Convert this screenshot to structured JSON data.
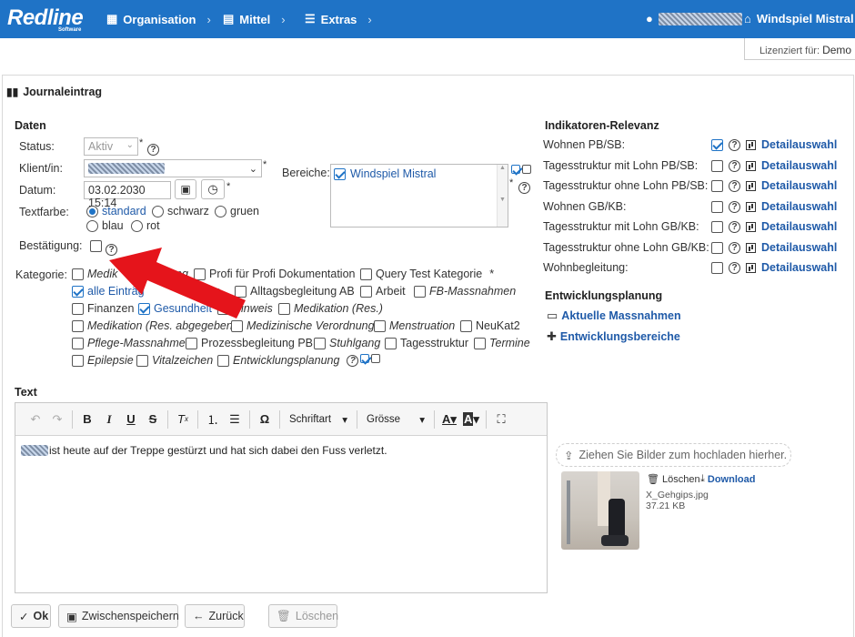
{
  "nav": {
    "logo": "Redline",
    "logo_sub": "Software",
    "items": [
      {
        "label": "Organisation",
        "icon": "building-icon"
      },
      {
        "label": "Mittel",
        "icon": "folder-icon"
      },
      {
        "label": "Extras",
        "icon": "menu-icon"
      }
    ],
    "home": "Windspiel Mistral"
  },
  "license": {
    "prefix": "Lizenziert für:",
    "name": "Demo"
  },
  "page_title": "Journaleintrag",
  "daten": {
    "title": "Daten",
    "status_label": "Status:",
    "status_value": "Aktiv",
    "klient_label": "Klient/in:",
    "datum_label": "Datum:",
    "datum_value": "03.02.2030 15:14",
    "textfarbe_label": "Textfarbe:",
    "colors": [
      "standard",
      "schwarz",
      "gruen",
      "blau",
      "rot"
    ],
    "bestaetigung_label": "Bestätigung:",
    "bereiche_label": "Bereiche:",
    "bereiche_item": "Windspiel Mistral",
    "required": "*"
  },
  "kategorie": {
    "label": "Kategorie:",
    "items": [
      "Medik",
      "ng",
      "Profi für Profi Dokumentation",
      "Query Test Kategorie",
      "alle Einträg",
      "e",
      "Alltagsbegleitung AB",
      "Arbeit",
      "FB-Massnahmen",
      "Finanzen",
      "Gesundheit",
      "Hinweis",
      "Medikation (Res.)",
      "Medikation (Res. abgegeben)",
      "Medizinische Verordnung",
      "Menstruation",
      "NeuKat2",
      "Pflege-Massnahme",
      "Prozessbegleitung PB",
      "Stuhlgang",
      "Tagesstruktur",
      "Termine",
      "Epilepsie",
      "Vitalzeichen",
      "Entwicklungsplanung"
    ]
  },
  "indikatoren": {
    "title": "Indikatoren-Relevanz",
    "link": "Detailauswahl",
    "rows": [
      "Wohnen PB/SB:",
      "Tagesstruktur mit Lohn PB/SB:",
      "Tagesstruktur ohne Lohn PB/SB:",
      "Wohnen GB/KB:",
      "Tagesstruktur mit Lohn GB/KB:",
      "Tagesstruktur ohne Lohn GB/KB:",
      "Wohnbegleitung:"
    ]
  },
  "entwicklung": {
    "title": "Entwicklungsplanung",
    "links": [
      "Aktuelle Massnahmen",
      "Entwicklungsbereiche"
    ]
  },
  "text": {
    "title": "Text",
    "toolbar": {
      "font": "Schriftart",
      "size": "Grösse",
      "omega": "Ω"
    },
    "body": "ist heute auf der Treppe gestürzt und hat sich dabei den Fuss verletzt."
  },
  "upload": {
    "dropzone": "Ziehen Sie Bilder zum hochladen hierher.",
    "delete": "Löschen",
    "download": "Download",
    "filename": "X_Gehgips.jpg",
    "filesize": "37.21 KB"
  },
  "buttons": {
    "ok": "Ok",
    "save": "Zwischenspeichern",
    "back": "Zurück",
    "delete": "Löschen"
  }
}
